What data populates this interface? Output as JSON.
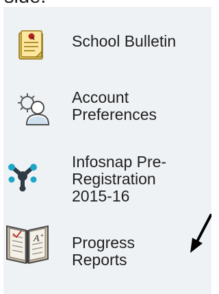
{
  "top_cutoff_text": "side.",
  "menu": {
    "items": [
      {
        "label": "School Bulletin",
        "icon": "bulletin-icon"
      },
      {
        "label": "Account\nPreferences",
        "icon": "account-preferences-icon"
      },
      {
        "label": "Infosnap Pre-\nRegistration\n2015-16",
        "icon": "infosnap-icon"
      },
      {
        "label": "Progress\nReports",
        "icon": "progress-reports-icon"
      }
    ]
  },
  "annotation": {
    "icon": "arrow-pointer-icon"
  },
  "colors": {
    "panel_bg": "#eff2f5",
    "text": "#1f1f1f",
    "infosnap_teal": "#1ea6c9",
    "infosnap_dark": "#2f3b45",
    "bulletin_paper": "#f5d97a",
    "pin_red": "#b3261e"
  }
}
